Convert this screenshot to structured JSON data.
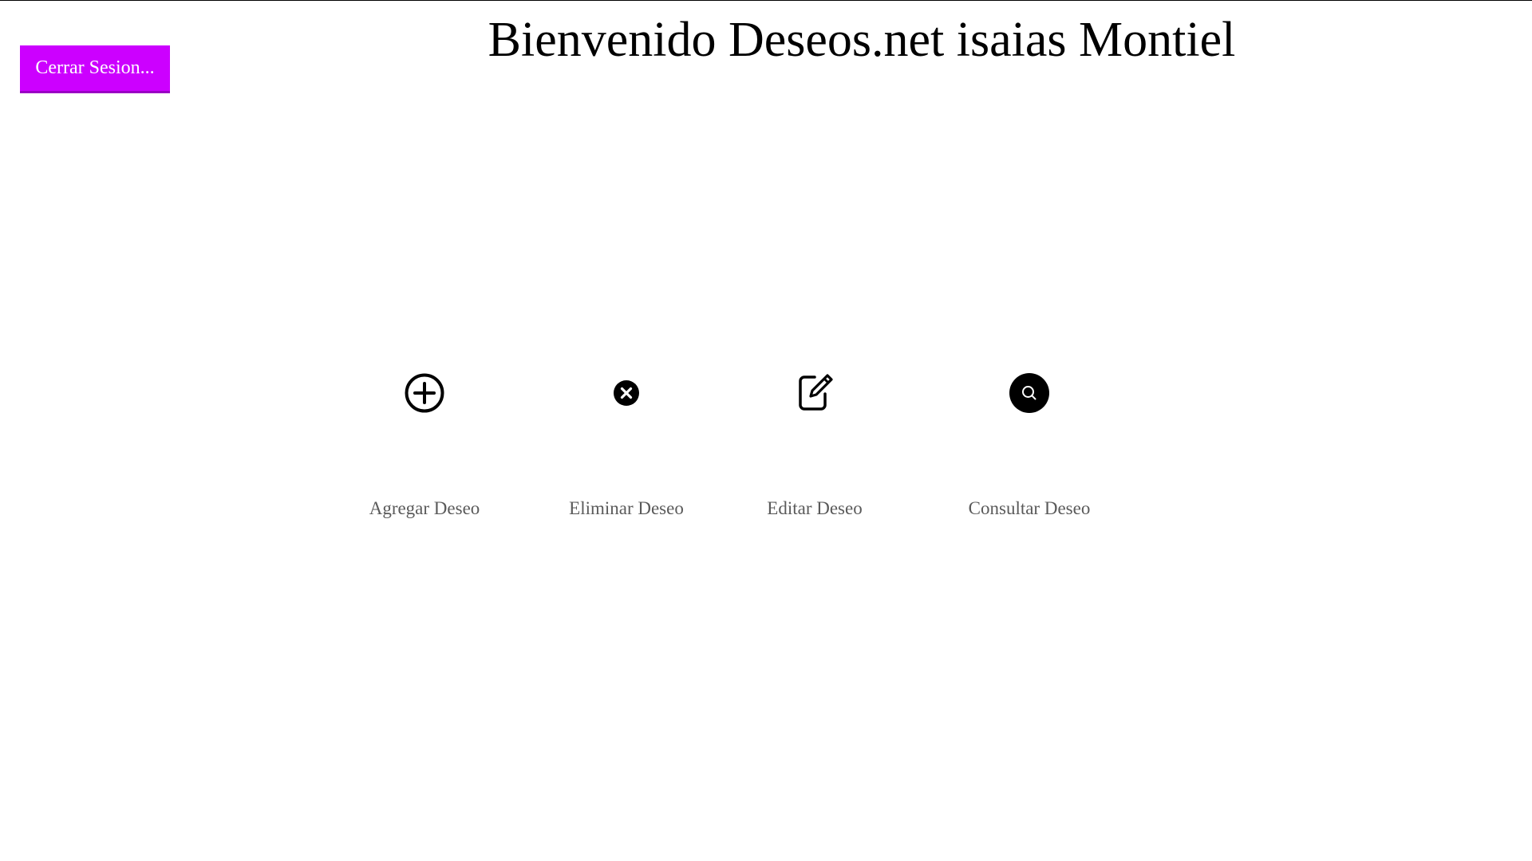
{
  "header": {
    "title": "Bienvenido Deseos.net isaias Montiel",
    "logout_label": "Cerrar Sesion..."
  },
  "actions": [
    {
      "label": "Agregar Deseo",
      "icon": "plus-circle-icon"
    },
    {
      "label": "Eliminar Deseo",
      "icon": "x-circle-icon"
    },
    {
      "label": "Editar Deseo",
      "icon": "edit-square-icon"
    },
    {
      "label": "Consultar Deseo",
      "icon": "search-circle-icon"
    }
  ],
  "colors": {
    "logout_button_bg": "#cc00ff",
    "title_text": "#000000",
    "action_label_text": "#5a5a5a",
    "icon": "#000000"
  }
}
